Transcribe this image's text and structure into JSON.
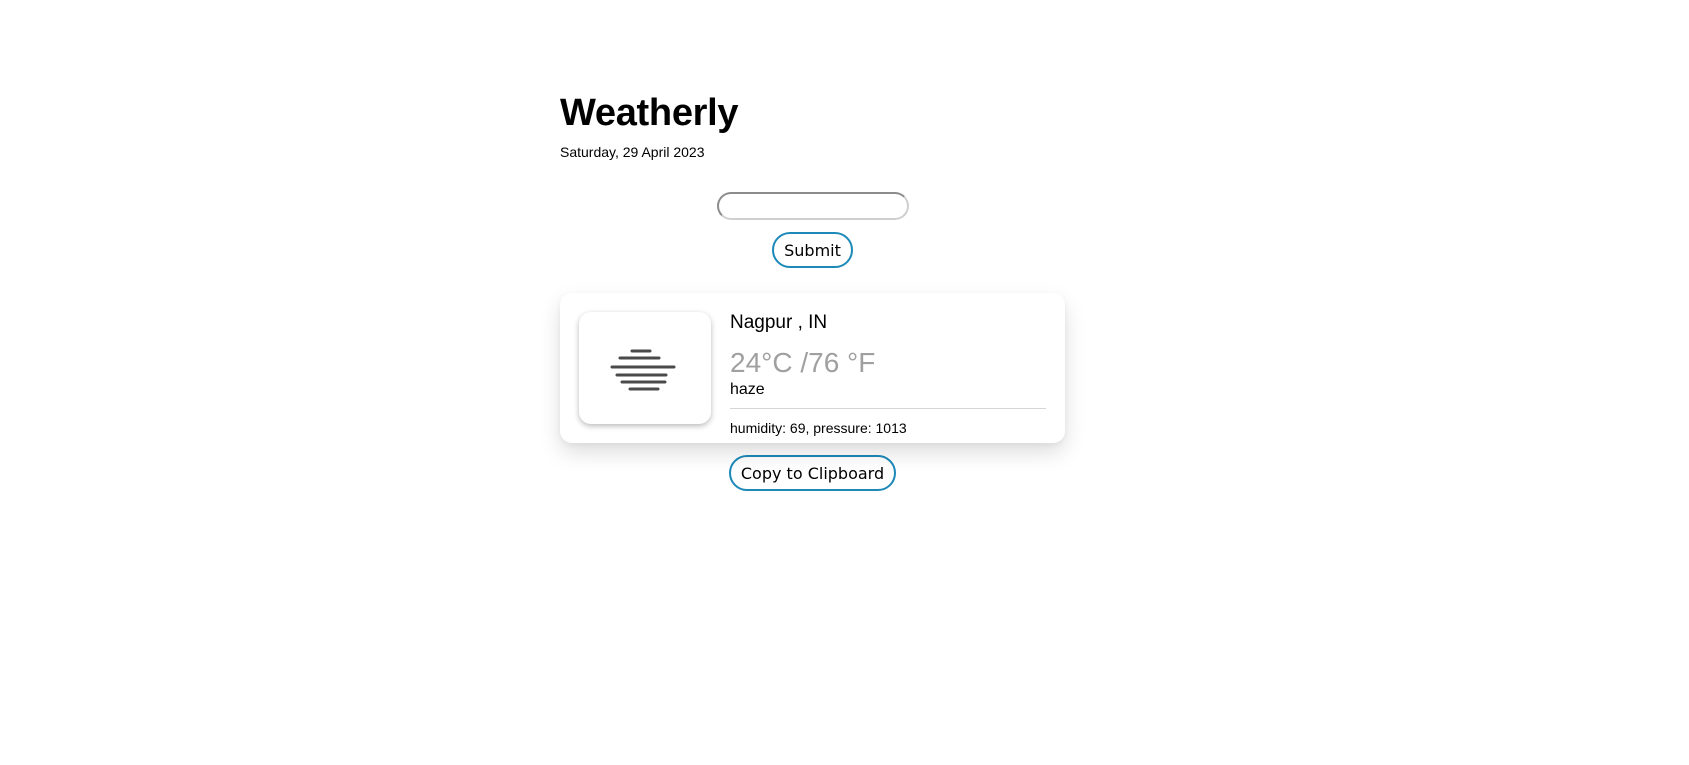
{
  "app": {
    "title": "Weatherly",
    "date": "Saturday, 29 April 2023"
  },
  "search": {
    "value": "",
    "submit_label": "Submit"
  },
  "weather": {
    "icon": "haze-icon",
    "location": "Nagpur , IN",
    "temperature": "24°C /76 °F",
    "description": "haze",
    "details": "humidity: 69, pressure: 1013"
  },
  "actions": {
    "copy_label": "Copy to Clipboard"
  },
  "colors": {
    "button_border": "#1d89b8",
    "temperature_text": "#a0a0a0",
    "icon_stroke": "#4a4a4a"
  }
}
